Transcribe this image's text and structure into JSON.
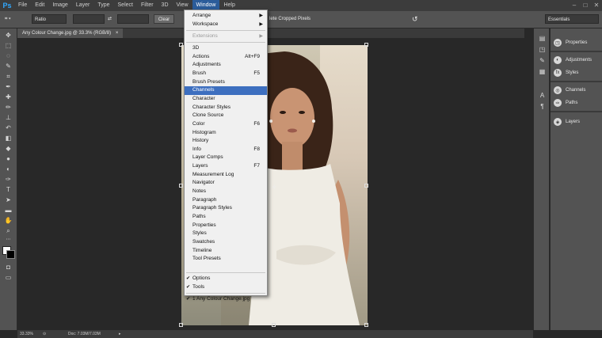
{
  "menubar": {
    "logo": "Ps",
    "items": [
      "File",
      "Edit",
      "Image",
      "Layer",
      "Type",
      "Select",
      "Filter",
      "3D",
      "View",
      "Window",
      "Help"
    ],
    "active": "Window"
  },
  "options": {
    "ratio": "Ratio",
    "clear": "Clear",
    "cropped": "lete Cropped Pixels",
    "workspace": "Essentials"
  },
  "document": {
    "tab": "Any Colour Change.jpg @ 33.3% (RGB/8)",
    "close": "×"
  },
  "status": {
    "zoom": "33.33%",
    "doc": "Doc: 7.03M/7.03M"
  },
  "right_panel": {
    "items": [
      "Properties",
      "Adjustments",
      "Styles",
      "Channels",
      "Paths",
      "Layers"
    ]
  },
  "window_menu": {
    "submenus": [
      {
        "label": "Arrange"
      },
      {
        "label": "Workspace"
      }
    ],
    "extensions": "Extensions",
    "items": [
      {
        "label": "3D",
        "shortcut": ""
      },
      {
        "label": "Actions",
        "shortcut": "Alt+F9"
      },
      {
        "label": "Adjustments",
        "shortcut": ""
      },
      {
        "label": "Brush",
        "shortcut": "F5"
      },
      {
        "label": "Brush Presets",
        "shortcut": ""
      },
      {
        "label": "Channels",
        "shortcut": ""
      },
      {
        "label": "Character",
        "shortcut": ""
      },
      {
        "label": "Character Styles",
        "shortcut": ""
      },
      {
        "label": "Clone Source",
        "shortcut": ""
      },
      {
        "label": "Color",
        "shortcut": "F6"
      },
      {
        "label": "Histogram",
        "shortcut": ""
      },
      {
        "label": "History",
        "shortcut": ""
      },
      {
        "label": "Info",
        "shortcut": "F8"
      },
      {
        "label": "Layer Comps",
        "shortcut": ""
      },
      {
        "label": "Layers",
        "shortcut": "F7"
      },
      {
        "label": "Measurement Log",
        "shortcut": ""
      },
      {
        "label": "Navigator",
        "shortcut": ""
      },
      {
        "label": "Notes",
        "shortcut": ""
      },
      {
        "label": "Paragraph",
        "shortcut": ""
      },
      {
        "label": "Paragraph Styles",
        "shortcut": ""
      },
      {
        "label": "Paths",
        "shortcut": ""
      },
      {
        "label": "Properties",
        "shortcut": ""
      },
      {
        "label": "Styles",
        "shortcut": ""
      },
      {
        "label": "Swatches",
        "shortcut": ""
      },
      {
        "label": "Timeline",
        "shortcut": ""
      },
      {
        "label": "Tool Presets",
        "shortcut": ""
      }
    ],
    "highlighted": "Channels",
    "checked_items": [
      "Options",
      "Tools"
    ],
    "open_docs": [
      "1 Any Colour Change.jpg"
    ]
  }
}
